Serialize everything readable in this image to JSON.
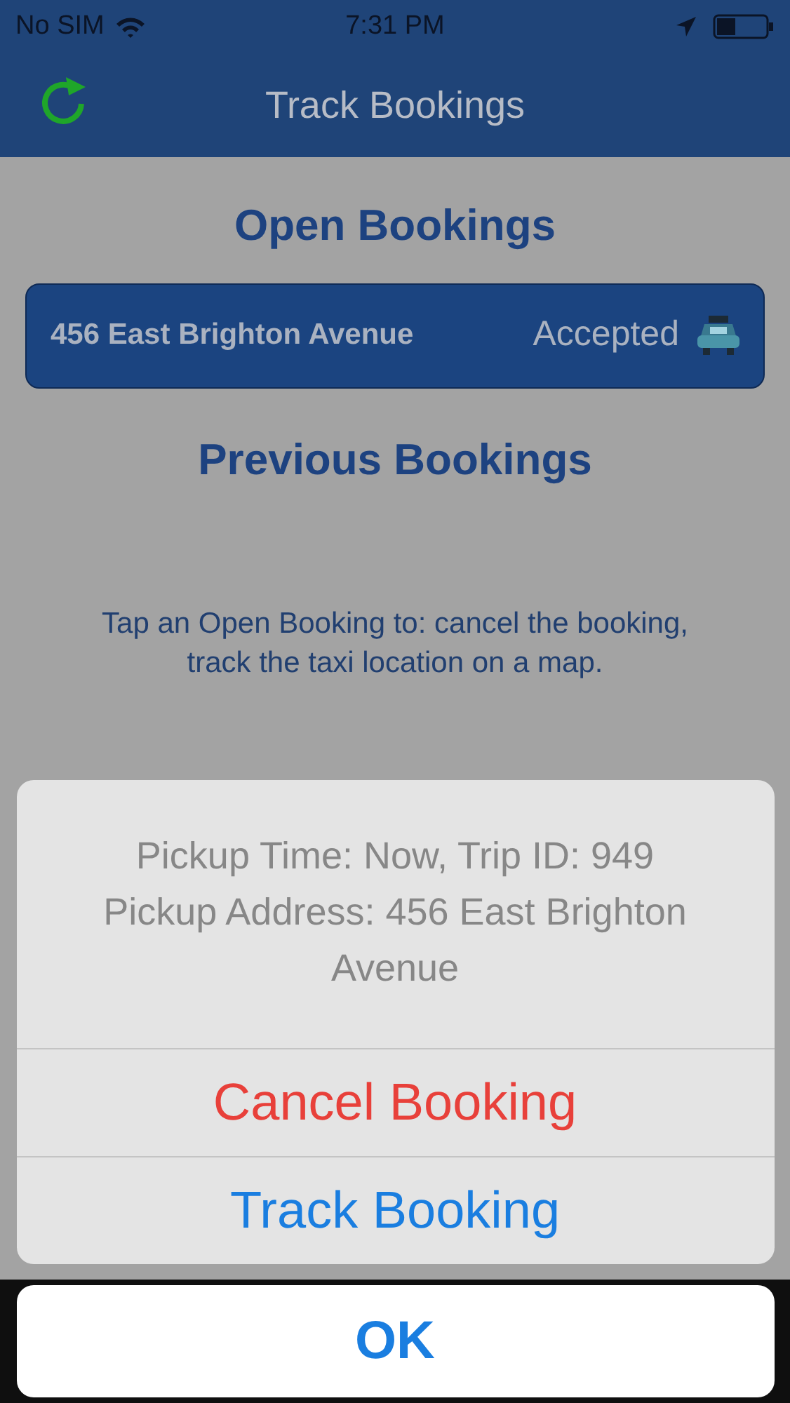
{
  "status_bar": {
    "carrier": "No SIM",
    "time": "7:31 PM"
  },
  "nav_bar": {
    "title": "Track Bookings"
  },
  "open_bookings": {
    "heading": "Open Bookings",
    "items": [
      {
        "address": "456 East Brighton Avenue",
        "status": "Accepted"
      }
    ]
  },
  "previous_bookings": {
    "heading": "Previous Bookings"
  },
  "hint": "Tap an Open Booking to: cancel the booking, track the taxi location on a map.",
  "action_sheet": {
    "message": "Pickup Time: Now, Trip ID: 949\nPickup Address: 456 East Brighton Avenue",
    "actions": [
      {
        "label": "Cancel Booking",
        "kind": "destructive"
      },
      {
        "label": "Track Booking",
        "kind": "default"
      }
    ],
    "cancel": "OK"
  }
}
